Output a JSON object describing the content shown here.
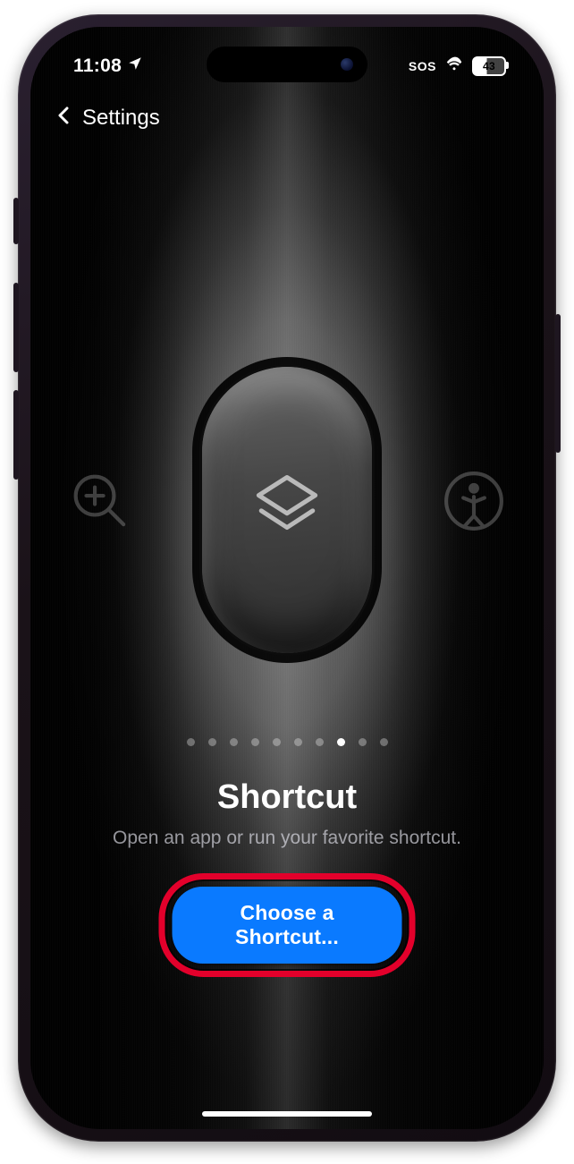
{
  "status_bar": {
    "time": "11:08",
    "location_icon": "location-arrow-icon",
    "sos": "SOS",
    "wifi_icon": "wifi-icon",
    "battery_icon": "battery-icon",
    "battery_percent": "43"
  },
  "nav": {
    "back_label": "Settings",
    "chevron_icon": "chevron-left-icon"
  },
  "carousel": {
    "left_icon": "magnifier-plus-icon",
    "right_icon": "accessibility-icon",
    "action_button_icon": "shortcuts-icon",
    "dot_count": 10,
    "active_index": 7
  },
  "content": {
    "title": "Shortcut",
    "subtitle": "Open an app or run your favorite shortcut.",
    "cta_label": "Choose a Shortcut..."
  },
  "annotation": {
    "highlight_color": "#e3002b"
  }
}
